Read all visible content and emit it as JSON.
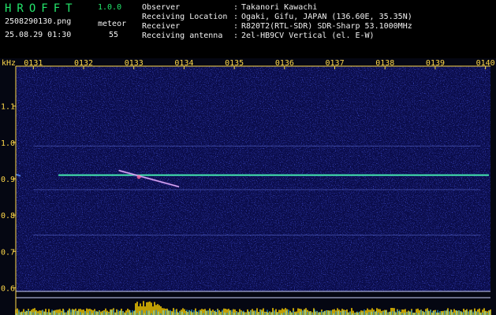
{
  "app": {
    "name": "HROFFT",
    "version": "1.0.0"
  },
  "file": {
    "name": "2508290130.png",
    "datetime": "25.08.29 01:30"
  },
  "meteor": {
    "label": "meteor",
    "count": "55"
  },
  "info": [
    {
      "label": "Observer",
      "value": "Takanori Kawachi"
    },
    {
      "label": "Receiving Location",
      "value": "Ogaki, Gifu, JAPAN (136.60E, 35.35N)"
    },
    {
      "label": "Receiver",
      "value": "R820T2(RTL-SDR) SDR-Sharp 53.1000MHz"
    },
    {
      "label": "Receiving antenna",
      "value": "2el-HB9CV Vertical (el. E-W)"
    }
  ],
  "colors": {
    "header_green": "#23e66b",
    "text_white": "#f2f2f2",
    "axis_yellow": "#ffd84a",
    "carrier_green": "#4dffb0",
    "baseline_yellow": "#ffd200",
    "noise_cyan": "#29b6ff"
  },
  "chart_data": {
    "type": "heatmap",
    "title": "",
    "ylabel": "kHz",
    "x_ticks": [
      "0131",
      "0132",
      "0133",
      "0134",
      "0135",
      "0136",
      "0137",
      "0138",
      "0139",
      "0140"
    ],
    "y_ticks": [
      "1.1",
      "1.0",
      "0.9",
      "0.8",
      "0.7",
      "0.6"
    ],
    "ylim": [
      0.59,
      1.21
    ],
    "carrier_khz": 0.91,
    "faint_lines_khz": [
      0.99,
      0.87,
      0.745
    ],
    "meteor_echo": {
      "start_time": "0132.7",
      "end_time": "0133.9",
      "start_khz": 0.923,
      "end_khz": 0.878
    },
    "grid": false
  }
}
